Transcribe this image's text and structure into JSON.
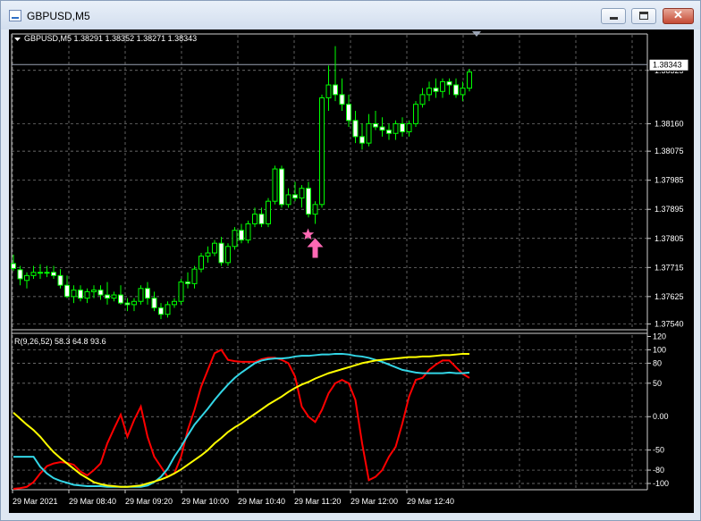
{
  "window": {
    "title": "GBPUSD,M5"
  },
  "main_panel": {
    "header": "GBPUSD,M5  1.38291 1.38352 1.38271 1.38343",
    "current_price_label": "1.38343"
  },
  "indicator_panel": {
    "header": "R(9,26,52) 58.3 64.8 93.6"
  },
  "colors": {
    "background": "#000000",
    "grid": "#8a8a8a",
    "bull_candle": "#00ff00",
    "bear_candle": "#ffffff",
    "series_red": "#ff0000",
    "series_cyan": "#33d6e6",
    "series_yellow": "#ffff00",
    "signal_marker": "#ff69b4"
  },
  "icons": {
    "signal_star": "star-icon",
    "signal_arrow": "up-arrow-icon"
  },
  "chart_data": [
    {
      "type": "candlestick",
      "title": "GBPUSD,M5",
      "y_ticks": [
        "1.38325",
        "1.38160",
        "1.38075",
        "1.37985",
        "1.37895",
        "1.37805",
        "1.37715",
        "1.37625",
        "1.37540"
      ],
      "x_ticks": [
        "29 Mar 2021",
        "29 Mar 08:40",
        "29 Mar 09:20",
        "29 Mar 10:00",
        "29 Mar 10:40",
        "29 Mar 11:20",
        "29 Mar 12:00",
        "29 Mar 12:40"
      ],
      "ylim": [
        1.37525,
        1.38435
      ],
      "current_price": 1.38343,
      "grid": true,
      "ohlc": [
        [
          1.37727,
          1.37755,
          1.37704,
          1.37712
        ],
        [
          1.37708,
          1.3772,
          1.3766,
          1.3768
        ],
        [
          1.37675,
          1.377,
          1.3765,
          1.3769
        ],
        [
          1.3769,
          1.3772,
          1.3768,
          1.377
        ],
        [
          1.377,
          1.37725,
          1.3768,
          1.377
        ],
        [
          1.377,
          1.3772,
          1.37685,
          1.377
        ],
        [
          1.377,
          1.3772,
          1.3768,
          1.3769
        ],
        [
          1.3769,
          1.3771,
          1.3765,
          1.3766
        ],
        [
          1.3766,
          1.3769,
          1.3762,
          1.37625
        ],
        [
          1.37625,
          1.3766,
          1.37605,
          1.37645
        ],
        [
          1.37645,
          1.3766,
          1.3761,
          1.3762
        ],
        [
          1.3762,
          1.3765,
          1.37605,
          1.3764
        ],
        [
          1.3764,
          1.3766,
          1.3762,
          1.37645
        ],
        [
          1.37645,
          1.3766,
          1.37615,
          1.3763
        ],
        [
          1.3763,
          1.3767,
          1.376,
          1.3762
        ],
        [
          1.3762,
          1.3764,
          1.3761,
          1.3763
        ],
        [
          1.3763,
          1.3766,
          1.376,
          1.37605
        ],
        [
          1.37605,
          1.3762,
          1.3758,
          1.376
        ],
        [
          1.376,
          1.3762,
          1.3758,
          1.3761
        ],
        [
          1.3761,
          1.3766,
          1.376,
          1.3765
        ],
        [
          1.3765,
          1.3767,
          1.376,
          1.3762
        ],
        [
          1.3762,
          1.3764,
          1.3758,
          1.3759
        ],
        [
          1.3759,
          1.37605,
          1.37555,
          1.3757
        ],
        [
          1.3757,
          1.3761,
          1.3756,
          1.376
        ],
        [
          1.376,
          1.3762,
          1.3759,
          1.3761
        ],
        [
          1.3761,
          1.3768,
          1.376,
          1.3767
        ],
        [
          1.3767,
          1.377,
          1.3765,
          1.37665
        ],
        [
          1.37665,
          1.3772,
          1.3765,
          1.3771
        ],
        [
          1.3771,
          1.3776,
          1.377,
          1.3775
        ],
        [
          1.3775,
          1.3778,
          1.3773,
          1.3776
        ],
        [
          1.3776,
          1.378,
          1.3775,
          1.3779
        ],
        [
          1.3779,
          1.3781,
          1.3772,
          1.3773
        ],
        [
          1.3773,
          1.3779,
          1.3772,
          1.3778
        ],
        [
          1.3778,
          1.3784,
          1.3777,
          1.3783
        ],
        [
          1.3783,
          1.3785,
          1.3779,
          1.378
        ],
        [
          1.378,
          1.3786,
          1.3779,
          1.3785
        ],
        [
          1.3785,
          1.379,
          1.3784,
          1.3788
        ],
        [
          1.3788,
          1.379,
          1.3784,
          1.3785
        ],
        [
          1.3785,
          1.3793,
          1.3784,
          1.3792
        ],
        [
          1.3792,
          1.3803,
          1.3791,
          1.3802
        ],
        [
          1.3802,
          1.3803,
          1.379,
          1.3791
        ],
        [
          1.3791,
          1.3796,
          1.379,
          1.3794
        ],
        [
          1.3794,
          1.3798,
          1.3792,
          1.3793
        ],
        [
          1.3793,
          1.3797,
          1.379,
          1.3796
        ],
        [
          1.3796,
          1.3798,
          1.3787,
          1.3788
        ],
        [
          1.3788,
          1.3792,
          1.3785,
          1.3791
        ],
        [
          1.3791,
          1.3825,
          1.379,
          1.3824
        ],
        [
          1.3824,
          1.3834,
          1.382,
          1.3828
        ],
        [
          1.3828,
          1.384,
          1.3823,
          1.3825
        ],
        [
          1.3825,
          1.383,
          1.382,
          1.3822
        ],
        [
          1.3822,
          1.3825,
          1.3815,
          1.3817
        ],
        [
          1.3817,
          1.382,
          1.381,
          1.3812
        ],
        [
          1.3812,
          1.3816,
          1.3808,
          1.381
        ],
        [
          1.381,
          1.3819,
          1.3809,
          1.3816
        ],
        [
          1.3816,
          1.382,
          1.3814,
          1.3815
        ],
        [
          1.3815,
          1.3818,
          1.3812,
          1.3814
        ],
        [
          1.3814,
          1.3816,
          1.3811,
          1.3813
        ],
        [
          1.3813,
          1.3817,
          1.3811,
          1.3816
        ],
        [
          1.3816,
          1.3818,
          1.3812,
          1.38135
        ],
        [
          1.38135,
          1.3817,
          1.3812,
          1.3816
        ],
        [
          1.3816,
          1.3823,
          1.3815,
          1.3822
        ],
        [
          1.3822,
          1.3827,
          1.3821,
          1.3825
        ],
        [
          1.3825,
          1.3829,
          1.3823,
          1.3827
        ],
        [
          1.3827,
          1.383,
          1.3824,
          1.3826
        ],
        [
          1.3826,
          1.383,
          1.3824,
          1.3829
        ],
        [
          1.3829,
          1.383,
          1.3825,
          1.3828
        ],
        [
          1.3828,
          1.383,
          1.3824,
          1.3825
        ],
        [
          1.3825,
          1.3829,
          1.3823,
          1.3827
        ],
        [
          1.3827,
          1.3833,
          1.3826,
          1.3832
        ]
      ],
      "signal": {
        "marker": "star + up arrow",
        "candle_index": 45
      }
    },
    {
      "type": "line",
      "title": "R(9,26,52) 58.3 64.8 93.6",
      "y_ticks": [
        120,
        100,
        80,
        50,
        0.0,
        -50,
        -80,
        -100
      ],
      "ylim": [
        -108,
        122
      ],
      "grid": true,
      "series": [
        {
          "color": "#ff0000",
          "values": [
            -108,
            -107,
            -105,
            -98,
            -85,
            -74,
            -70,
            -68,
            -69,
            -72,
            -82,
            -88,
            -80,
            -70,
            -40,
            -18,
            3,
            -30,
            -5,
            15,
            -30,
            -60,
            -75,
            -90,
            -85,
            -60,
            -20,
            10,
            45,
            70,
            95,
            100,
            85,
            83,
            82,
            82,
            82,
            86,
            88,
            88,
            85,
            80,
            60,
            15,
            0,
            -8,
            10,
            35,
            50,
            55,
            50,
            25,
            -40,
            -95,
            -90,
            -80,
            -60,
            -45,
            -10,
            30,
            55,
            58,
            70,
            78,
            84,
            84,
            74,
            64,
            58
          ]
        },
        {
          "color": "#33d6e6",
          "values": [
            -60,
            -60,
            -60,
            -60,
            -75,
            -85,
            -92,
            -96,
            -99,
            -102,
            -103,
            -104,
            -104,
            -104,
            -105,
            -105,
            -105,
            -105,
            -105,
            -105,
            -103,
            -98,
            -90,
            -78,
            -60,
            -45,
            -28,
            -12,
            0,
            12,
            25,
            37,
            48,
            58,
            66,
            73,
            80,
            84,
            86,
            87,
            87,
            88,
            90,
            91,
            91,
            92,
            93,
            93,
            94,
            94,
            93,
            91,
            90,
            88,
            85,
            82,
            78,
            74,
            70,
            68,
            66,
            65,
            65,
            65,
            65,
            66,
            65,
            65,
            66
          ]
        },
        {
          "color": "#ffff00",
          "values": [
            6,
            -3,
            -12,
            -20,
            -30,
            -42,
            -53,
            -62,
            -70,
            -78,
            -86,
            -92,
            -98,
            -101,
            -103,
            -104,
            -105,
            -105,
            -104,
            -103,
            -100,
            -97,
            -94,
            -90,
            -85,
            -79,
            -72,
            -65,
            -58,
            -50,
            -40,
            -32,
            -23,
            -16,
            -10,
            -3,
            4,
            11,
            18,
            24,
            30,
            37,
            43,
            48,
            52,
            57,
            61,
            65,
            68,
            71,
            74,
            77,
            80,
            82,
            84,
            85,
            86,
            87,
            88,
            89,
            89,
            90,
            90,
            91,
            92,
            92,
            93,
            94,
            94
          ]
        }
      ]
    }
  ]
}
